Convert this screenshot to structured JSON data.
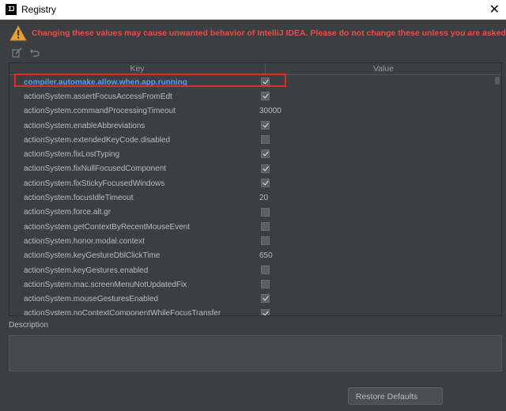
{
  "window": {
    "title": "Registry",
    "app_icon_text": "IJ",
    "close_glyph": "✕"
  },
  "warning": {
    "icon": "warning-triangle-icon",
    "text": "Changing these values may cause unwanted behavior of IntelliJ IDEA. Please do not change these unless you are asked."
  },
  "toolbar": {
    "edit_icon": "edit-icon",
    "revert_icon": "revert-icon"
  },
  "table": {
    "columns": [
      "Key",
      "Value"
    ],
    "rows": [
      {
        "key": "compiler.automake.allow.when.app.running",
        "type": "checkbox",
        "checked": true,
        "selected": true
      },
      {
        "key": "actionSystem.assertFocusAccessFromEdt",
        "type": "checkbox",
        "checked": true
      },
      {
        "key": "actionSystem.commandProcessingTimeout",
        "type": "text",
        "value": "30000"
      },
      {
        "key": "actionSystem.enableAbbreviations",
        "type": "checkbox",
        "checked": true
      },
      {
        "key": "actionSystem.extendedKeyCode.disabled",
        "type": "checkbox",
        "checked": false
      },
      {
        "key": "actionSystem.fixLostTyping",
        "type": "checkbox",
        "checked": true
      },
      {
        "key": "actionSystem.fixNullFocusedComponent",
        "type": "checkbox",
        "checked": true
      },
      {
        "key": "actionSystem.fixStickyFocusedWindows",
        "type": "checkbox",
        "checked": true
      },
      {
        "key": "actionSystem.focusIdleTimeout",
        "type": "text",
        "value": "20"
      },
      {
        "key": "actionSystem.force.alt.gr",
        "type": "checkbox",
        "checked": false
      },
      {
        "key": "actionSystem.getContextByRecentMouseEvent",
        "type": "checkbox",
        "checked": false
      },
      {
        "key": "actionSystem.honor.modal.context",
        "type": "checkbox",
        "checked": false
      },
      {
        "key": "actionSystem.keyGestureDblClickTime",
        "type": "text",
        "value": "650"
      },
      {
        "key": "actionSystem.keyGestures.enabled",
        "type": "checkbox",
        "checked": false
      },
      {
        "key": "actionSystem.mac.screenMenuNotUpdatedFix",
        "type": "checkbox",
        "checked": false
      },
      {
        "key": "actionSystem.mouseGesturesEnabled",
        "type": "checkbox",
        "checked": true
      },
      {
        "key": "actionSystem.noContextComponentWhileFocusTransfer",
        "type": "checkbox",
        "checked": true
      }
    ]
  },
  "description": {
    "label": "Description",
    "text": ""
  },
  "buttons": {
    "restore_defaults": "Restore Defaults"
  },
  "colors": {
    "background": "#3c3f41",
    "warning_text": "#e84d4d",
    "selected_key": "#5a9ef0",
    "highlight_border": "#e02b2b"
  }
}
